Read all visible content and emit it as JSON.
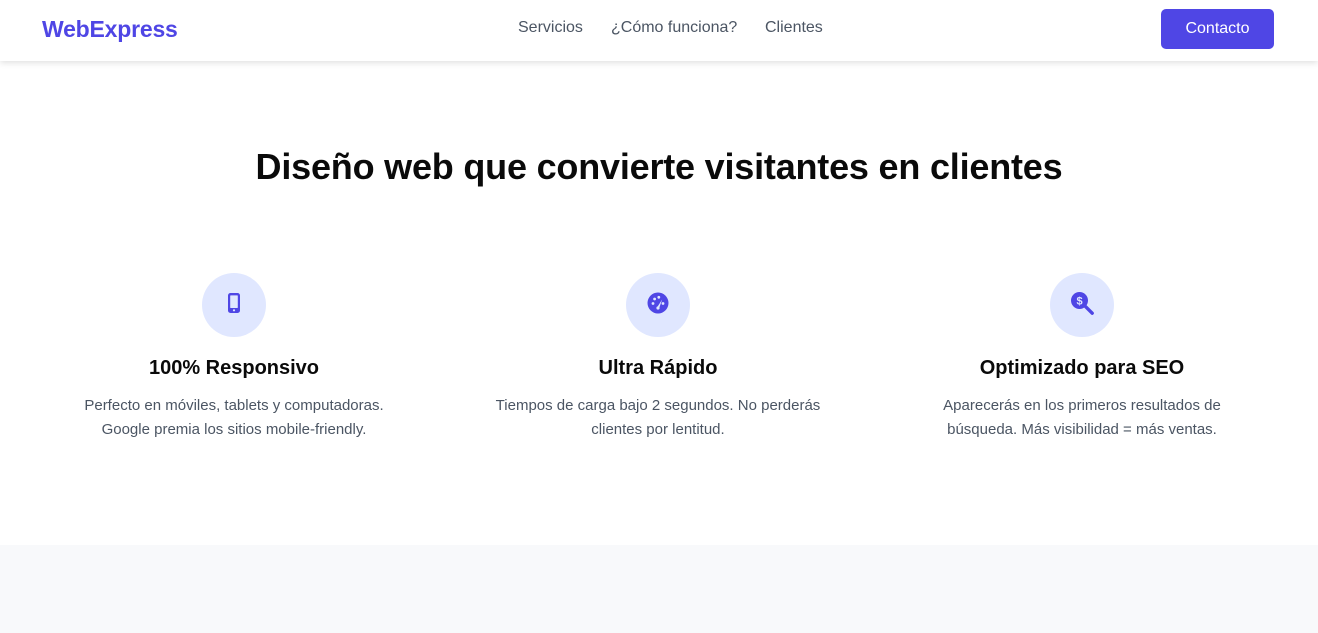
{
  "brand": {
    "name": "WebExpress",
    "color": "#4f46e5"
  },
  "nav": {
    "links": [
      {
        "label": "Servicios"
      },
      {
        "label": "¿Cómo funciona?"
      },
      {
        "label": "Clientes"
      }
    ],
    "cta_label": "Contacto"
  },
  "hero": {
    "title": "Diseño web que convierte visitantes en clientes"
  },
  "features": [
    {
      "icon": "mobile-phone-icon",
      "title": "100% Responsivo",
      "description": "Perfecto en móviles, tablets y computadoras. Google premia los sitios mobile-friendly."
    },
    {
      "icon": "speedometer-icon",
      "title": "Ultra Rápido",
      "description": "Tiempos de carga bajo 2 segundos. No perderás clientes por lentitud."
    },
    {
      "icon": "search-dollar-icon",
      "title": "Optimizado para SEO",
      "description": "Aparecerás en los primeros resultados de búsqueda. Más visibilidad = más ventas."
    }
  ],
  "colors": {
    "accent": "#4f46e5",
    "icon_background": "#e0e7ff",
    "muted_text": "#4b5563",
    "section_background": "#f8f9fb"
  }
}
